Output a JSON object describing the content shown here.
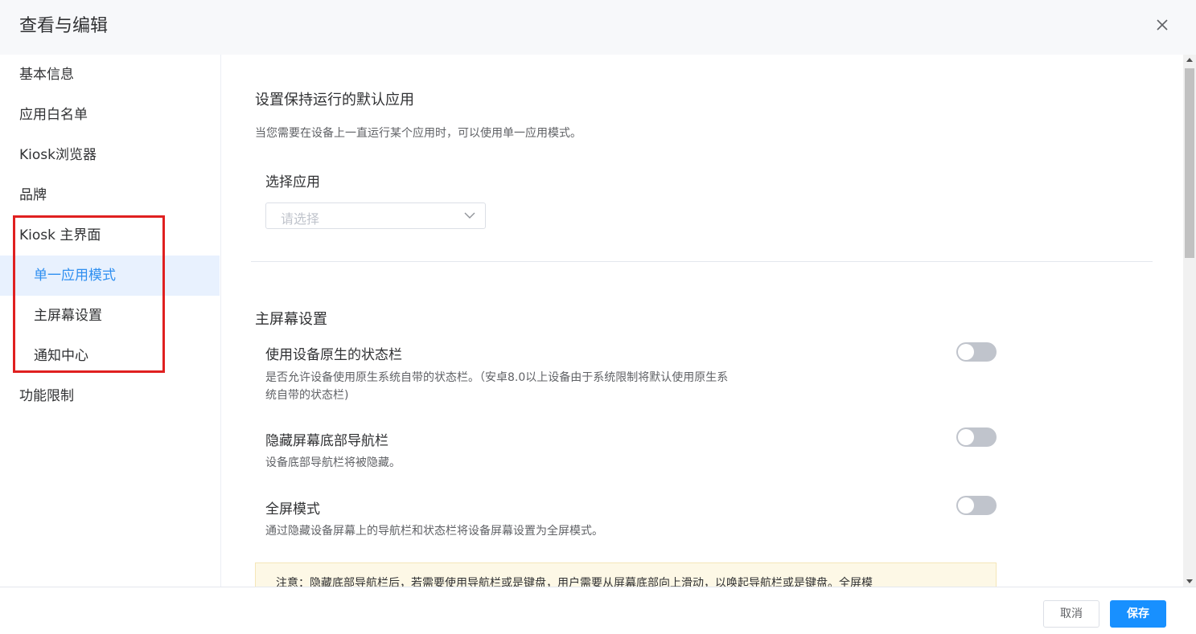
{
  "dialog": {
    "title": "查看与编辑",
    "close_icon": "close-icon"
  },
  "sidebar": {
    "items": [
      {
        "label": "基本信息"
      },
      {
        "label": "应用白名单"
      },
      {
        "label": "Kiosk浏览器"
      },
      {
        "label": "品牌"
      },
      {
        "label": "Kiosk 主界面"
      },
      {
        "label": "单一应用模式",
        "active": true
      },
      {
        "label": "主屏幕设置"
      },
      {
        "label": "通知中心"
      },
      {
        "label": "功能限制"
      }
    ],
    "active_color": "#2f8ff0",
    "highlight_color": "#e02020"
  },
  "single_app": {
    "title": "设置保持运行的默认应用",
    "description": "当您需要在设备上一直运行某个应用时，可以使用单一应用模式。",
    "select_label": "选择应用",
    "select_placeholder": "请选择"
  },
  "home_screen": {
    "title": "主屏幕设置",
    "settings": [
      {
        "label": "使用设备原生的状态栏",
        "desc_line1": "是否允许设备使用原生系统自带的状态栏。（安卓8.0以上设备由于系统限制将默认使用原生系",
        "desc_line2": "统自带的状态栏)",
        "enabled": false
      },
      {
        "label": "隐藏屏幕底部导航栏",
        "desc_line1": "设备底部导航栏将被隐藏。",
        "enabled": false
      },
      {
        "label": "全屏模式",
        "desc_line1": "通过隐藏设备屏幕上的导航栏和状态栏将设备屏幕设置为全屏模式。",
        "enabled": false
      }
    ],
    "notice": "注意：隐藏底部导航栏后，若需要使用导航栏或是键盘，用户需要从屏幕底部向上滑动，以唤起导航栏或是键盘。全屏模"
  },
  "footer": {
    "cancel_label": "取消",
    "save_label": "保存",
    "primary_color": "#1890ff"
  }
}
